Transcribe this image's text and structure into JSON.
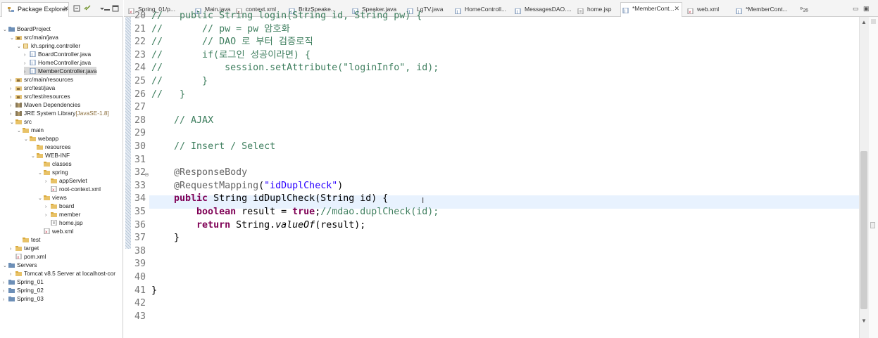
{
  "explorer": {
    "title": "Package Explorer",
    "tree": [
      {
        "label": "BoardProject",
        "deco": "",
        "lvl": 0,
        "tw": "v",
        "icon": "project",
        "sel": false
      },
      {
        "label": "src/main/java",
        "deco": "",
        "lvl": 1,
        "tw": "v",
        "icon": "srcfolder",
        "sel": false
      },
      {
        "label": "kh.spring.controller",
        "deco": "",
        "lvl": 2,
        "tw": "v",
        "icon": "package",
        "sel": false
      },
      {
        "label": "BoardController.java",
        "deco": "",
        "lvl": 3,
        "tw": ">",
        "icon": "java",
        "sel": false
      },
      {
        "label": "HomeController.java",
        "deco": "",
        "lvl": 3,
        "tw": ">",
        "icon": "java",
        "sel": false
      },
      {
        "label": "MemberController.java",
        "deco": "",
        "lvl": 3,
        "tw": ">",
        "icon": "java",
        "sel": true
      },
      {
        "label": "src/main/resources",
        "deco": "",
        "lvl": 1,
        "tw": ">",
        "icon": "srcfolder",
        "sel": false
      },
      {
        "label": "src/test/java",
        "deco": "",
        "lvl": 1,
        "tw": ">",
        "icon": "srcfolder",
        "sel": false
      },
      {
        "label": "src/test/resources",
        "deco": "",
        "lvl": 1,
        "tw": ">",
        "icon": "srcfolder",
        "sel": false
      },
      {
        "label": "Maven Dependencies",
        "deco": "",
        "lvl": 1,
        "tw": ">",
        "icon": "library",
        "sel": false
      },
      {
        "label": "JRE System Library",
        "deco": "[JavaSE-1.8]",
        "lvl": 1,
        "tw": ">",
        "icon": "library",
        "sel": false
      },
      {
        "label": "src",
        "deco": "",
        "lvl": 1,
        "tw": "v",
        "icon": "folder",
        "sel": false
      },
      {
        "label": "main",
        "deco": "",
        "lvl": 2,
        "tw": "v",
        "icon": "folder",
        "sel": false
      },
      {
        "label": "webapp",
        "deco": "",
        "lvl": 3,
        "tw": "v",
        "icon": "folder",
        "sel": false
      },
      {
        "label": "resources",
        "deco": "",
        "lvl": 4,
        "tw": "",
        "icon": "folder",
        "sel": false
      },
      {
        "label": "WEB-INF",
        "deco": "",
        "lvl": 4,
        "tw": "v",
        "icon": "folder",
        "sel": false
      },
      {
        "label": "classes",
        "deco": "",
        "lvl": 5,
        "tw": "",
        "icon": "folder",
        "sel": false
      },
      {
        "label": "spring",
        "deco": "",
        "lvl": 5,
        "tw": "v",
        "icon": "folder",
        "sel": false
      },
      {
        "label": "appServlet",
        "deco": "",
        "lvl": 6,
        "tw": ">",
        "icon": "folder",
        "sel": false
      },
      {
        "label": "root-context.xml",
        "deco": "",
        "lvl": 6,
        "tw": "",
        "icon": "xml",
        "sel": false
      },
      {
        "label": "views",
        "deco": "",
        "lvl": 5,
        "tw": "v",
        "icon": "folder",
        "sel": false
      },
      {
        "label": "board",
        "deco": "",
        "lvl": 6,
        "tw": ">",
        "icon": "folder",
        "sel": false
      },
      {
        "label": "member",
        "deco": "",
        "lvl": 6,
        "tw": ">",
        "icon": "folder",
        "sel": false
      },
      {
        "label": "home.jsp",
        "deco": "",
        "lvl": 6,
        "tw": "",
        "icon": "jsp",
        "sel": false
      },
      {
        "label": "web.xml",
        "deco": "",
        "lvl": 5,
        "tw": "",
        "icon": "xml",
        "sel": false
      },
      {
        "label": "test",
        "deco": "",
        "lvl": 2,
        "tw": "",
        "icon": "folder",
        "sel": false
      },
      {
        "label": "target",
        "deco": "",
        "lvl": 1,
        "tw": ">",
        "icon": "folder",
        "sel": false
      },
      {
        "label": "pom.xml",
        "deco": "",
        "lvl": 1,
        "tw": "",
        "icon": "xml",
        "sel": false
      },
      {
        "label": "Servers",
        "deco": "",
        "lvl": 0,
        "tw": "v",
        "icon": "project",
        "sel": false
      },
      {
        "label": "Tomcat v8.5 Server at localhost-cor",
        "deco": "",
        "lvl": 1,
        "tw": ">",
        "icon": "folder",
        "sel": false
      },
      {
        "label": "Spring_01",
        "deco": "",
        "lvl": 0,
        "tw": ">",
        "icon": "project",
        "sel": false
      },
      {
        "label": "Spring_02",
        "deco": "",
        "lvl": 0,
        "tw": ">",
        "icon": "project",
        "sel": false
      },
      {
        "label": "Spring_03",
        "deco": "",
        "lvl": 0,
        "tw": ">",
        "icon": "project",
        "sel": false
      }
    ]
  },
  "editor": {
    "tabs": [
      {
        "label": "Spring_01/p...",
        "icon": "xml",
        "active": false
      },
      {
        "label": "Main.java",
        "icon": "java",
        "active": false
      },
      {
        "label": "context.xml",
        "icon": "xml",
        "active": false
      },
      {
        "label": "BritzSpeake...",
        "icon": "java",
        "active": false
      },
      {
        "label": "Speaker.java",
        "icon": "java",
        "active": false
      },
      {
        "label": "LgTV.java",
        "icon": "java",
        "active": false
      },
      {
        "label": "HomeControll...",
        "icon": "java",
        "active": false
      },
      {
        "label": "MessagesDAO....",
        "icon": "java",
        "active": false
      },
      {
        "label": "home.jsp",
        "icon": "jsp",
        "active": false
      },
      {
        "label": "*MemberCont...",
        "icon": "java",
        "active": true
      },
      {
        "label": "web.xml",
        "icon": "xml",
        "active": false
      },
      {
        "label": "*MemberCont...",
        "icon": "java",
        "active": false
      }
    ],
    "more_tabs": "26",
    "lines": [
      {
        "n": "20",
        "t": "//   public String login(String id, String pw) {"
      },
      {
        "n": "21",
        "t": "//       // pw = pw 암호화"
      },
      {
        "n": "22",
        "t": "//       // DAO 로 부터 검증로직"
      },
      {
        "n": "23",
        "t": "//       if(로그인 성공이라면) {"
      },
      {
        "n": "24",
        "t": "//           session.setAttribute(\"loginInfo\", id);"
      },
      {
        "n": "25",
        "t": "//       }"
      },
      {
        "n": "26",
        "t": "//   }"
      },
      {
        "n": "27",
        "t": ""
      },
      {
        "n": "28",
        "t": "    // AJAX"
      },
      {
        "n": "29",
        "t": ""
      },
      {
        "n": "30",
        "t": "    // Insert / Select"
      },
      {
        "n": "31",
        "t": ""
      },
      {
        "n": "32",
        "t": "    @ResponseBody"
      },
      {
        "n": "33",
        "t": "    @RequestMapping(\"idDuplCheck\")"
      },
      {
        "n": "34",
        "t": "    public String idDuplCheck(String id) {"
      },
      {
        "n": "35",
        "t": "        boolean result = true;//mdao.duplCheck(id);"
      },
      {
        "n": "36",
        "t": "        return String.valueOf(result);"
      },
      {
        "n": "37",
        "t": "    }"
      },
      {
        "n": "38",
        "t": ""
      },
      {
        "n": "39",
        "t": ""
      },
      {
        "n": "40",
        "t": ""
      },
      {
        "n": "41",
        "t": "}"
      },
      {
        "n": "42",
        "t": ""
      },
      {
        "n": "43",
        "t": ""
      }
    ]
  }
}
